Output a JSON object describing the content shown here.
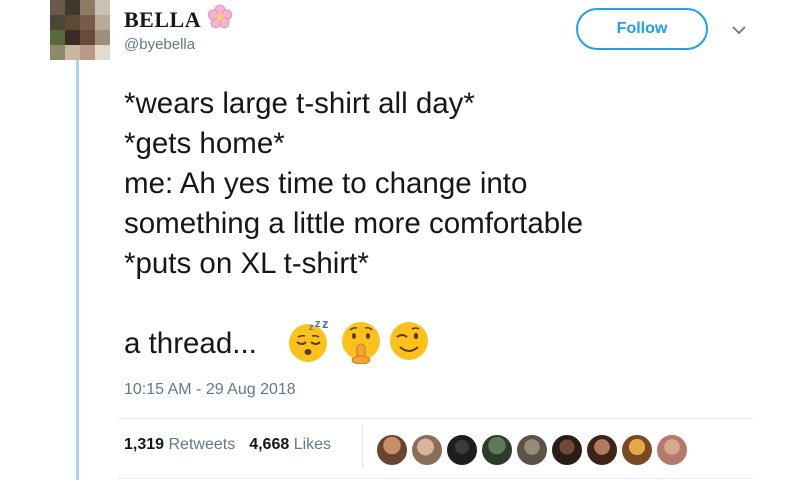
{
  "tweet": {
    "display_name": "BELLA",
    "handle": "@byebella",
    "follow_label": "Follow",
    "lines": [
      "*wears large t-shirt all day*",
      "*gets home*",
      "me: Ah yes time to change into",
      "something a little more comfortable",
      "*puts on XL t-shirt*"
    ],
    "thread_line": "a thread...",
    "emojis": [
      "sleeping-face",
      "shushing-face",
      "winking-face"
    ],
    "timestamp": "10:15 AM - 29 Aug 2018"
  },
  "stats": {
    "retweets_count": "1,319",
    "retweets_label": "Retweets",
    "likes_count": "4,668",
    "likes_label": "Likes"
  },
  "likers": [
    {
      "name": "liker-avatar-1"
    },
    {
      "name": "liker-avatar-2"
    },
    {
      "name": "liker-avatar-3"
    },
    {
      "name": "liker-avatar-4"
    },
    {
      "name": "liker-avatar-5"
    },
    {
      "name": "liker-avatar-6"
    },
    {
      "name": "liker-avatar-7"
    },
    {
      "name": "liker-avatar-8"
    },
    {
      "name": "liker-avatar-9"
    }
  ],
  "colors": {
    "accent": "#1da1f2",
    "thread_line": "#a3d3f5",
    "secondary_text": "#657786",
    "divider": "#e6ecf0"
  }
}
